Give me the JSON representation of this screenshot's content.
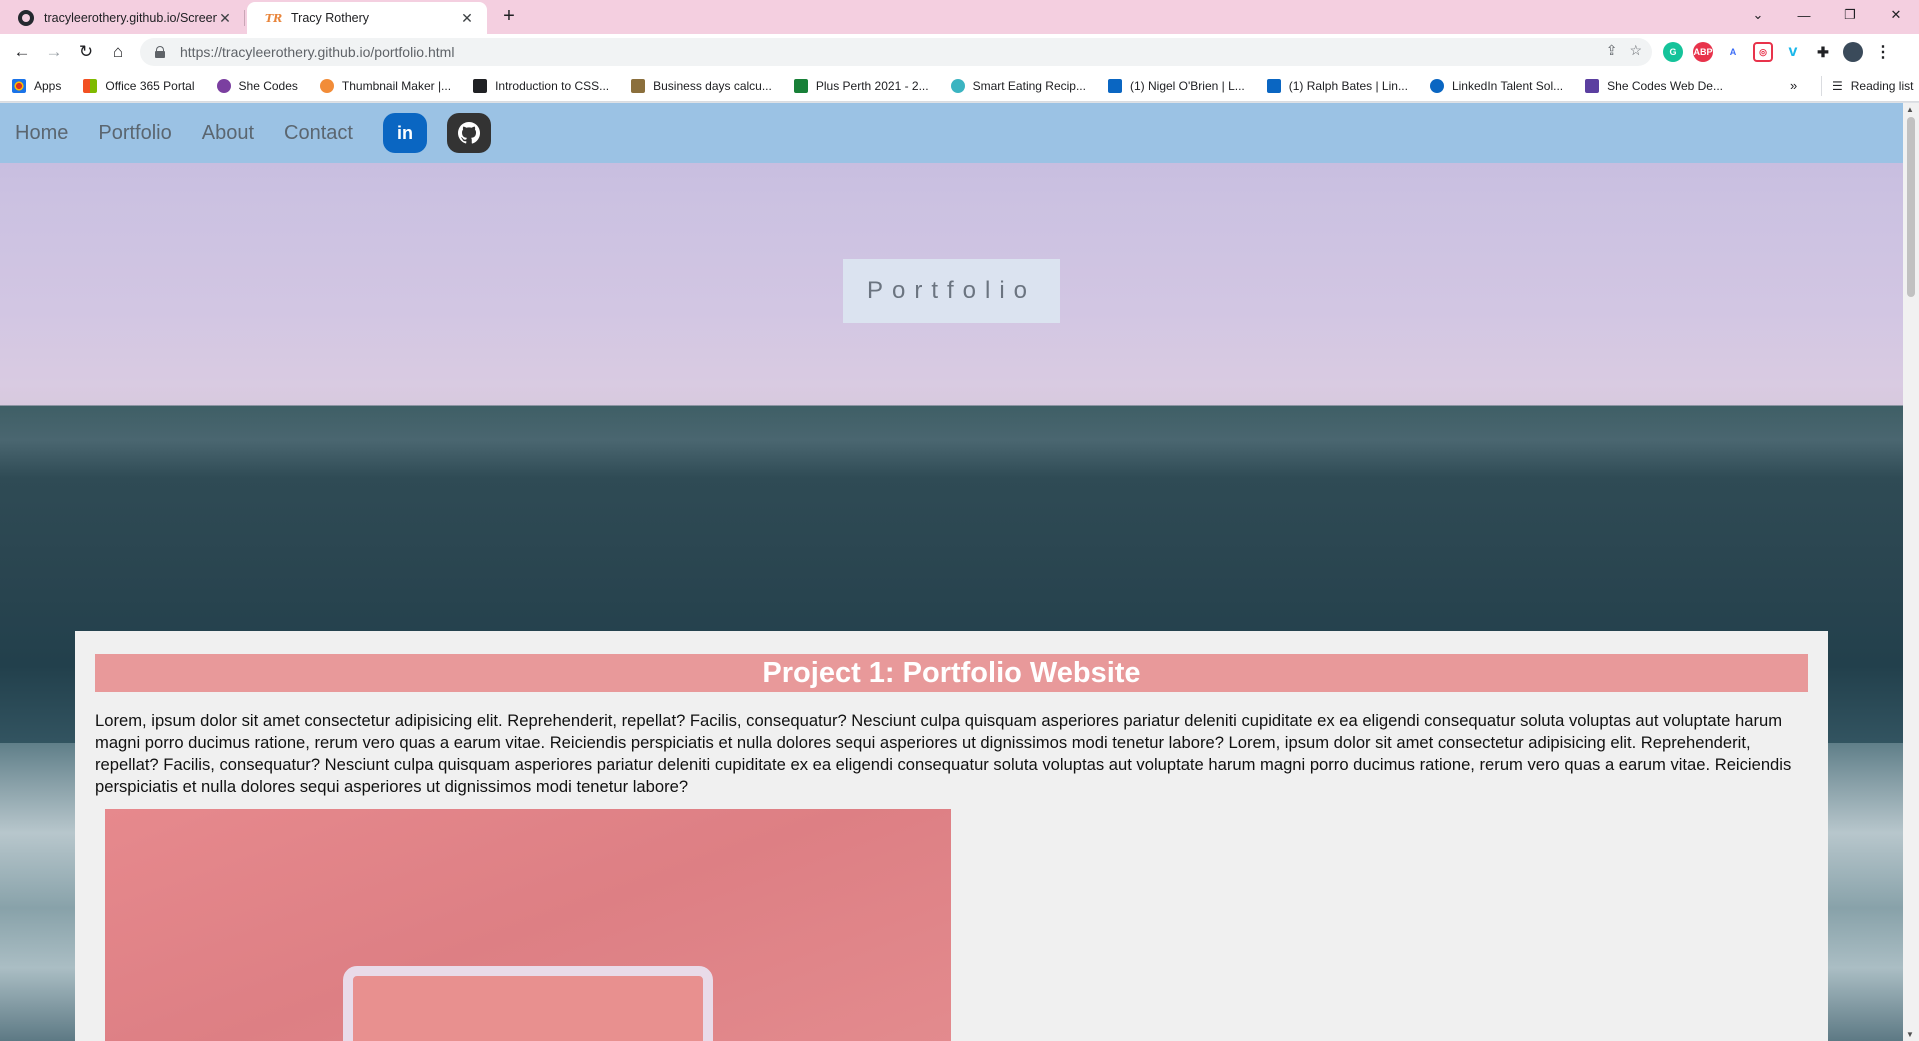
{
  "browser": {
    "tabs": [
      {
        "title": "tracyleerothery.github.io/Screens",
        "favicon": "github-icon",
        "active": false
      },
      {
        "title": "Tracy Rothery",
        "favicon": "tr-logo-icon",
        "active": true
      }
    ],
    "url": "https://tracyleerothery.github.io/portfolio.html",
    "bookmarks": [
      {
        "label": "Apps",
        "icon": "apps-grid-icon",
        "color": "#d93025"
      },
      {
        "label": "Office 365 Portal",
        "icon": "office-icon",
        "color": "#e8542f"
      },
      {
        "label": "She Codes",
        "icon": "shecodes-icon",
        "color": "#7b3fa0"
      },
      {
        "label": "Thumbnail Maker |...",
        "icon": "thumbnail-icon",
        "color": "#f28c38"
      },
      {
        "label": "Introduction to CSS...",
        "icon": "css-icon",
        "color": "#202124"
      },
      {
        "label": "Business days calcu...",
        "icon": "calendar-icon",
        "color": "#8b6f3c"
      },
      {
        "label": "Plus Perth 2021 - 2...",
        "icon": "sheets-icon",
        "color": "#188038"
      },
      {
        "label": "Smart Eating Recip...",
        "icon": "recipe-icon",
        "color": "#3bb4c1"
      },
      {
        "label": "(1) Nigel O'Brien | L...",
        "icon": "linkedin-icon",
        "color": "#0a66c2"
      },
      {
        "label": "(1) Ralph Bates | Lin...",
        "icon": "linkedin-icon",
        "color": "#0a66c2"
      },
      {
        "label": "LinkedIn Talent Sol...",
        "icon": "talent-icon",
        "color": "#0a66c2"
      },
      {
        "label": "She Codes Web De...",
        "icon": "shecodes-web-icon",
        "color": "#5b3fa0"
      }
    ],
    "reading_list": "Reading list"
  },
  "site": {
    "nav": [
      "Home",
      "Portfolio",
      "About",
      "Contact"
    ],
    "hero_title": "Portfolio",
    "project": {
      "heading": "Project 1: Portfolio Website",
      "description": "Lorem, ipsum dolor sit amet consectetur adipisicing elit. Reprehenderit, repellat? Facilis, consequatur? Nesciunt culpa quisquam asperiores pariatur deleniti cupiditate ex ea eligendi consequatur soluta voluptas aut voluptate harum magni porro ducimus ratione, rerum vero quas a earum vitae. Reiciendis perspiciatis et nulla dolores sequi asperiores ut dignissimos modi tenetur labore? Lorem, ipsum dolor sit amet consectetur adipisicing elit. Reprehenderit, repellat? Facilis, consequatur? Nesciunt culpa quisquam asperiores pariatur deleniti cupiditate ex ea eligendi consequatur soluta voluptas aut voluptate harum magni porro ducimus ratione, rerum vero quas a earum vitae. Reiciendis perspiciatis et nulla dolores sequi asperiores ut dignissimos modi tenetur labore?"
    }
  }
}
